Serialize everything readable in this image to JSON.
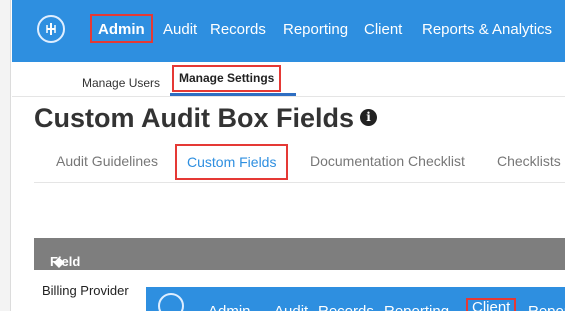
{
  "nav": {
    "items": [
      "Admin",
      "Audit",
      "Records",
      "Reporting",
      "Client",
      "Reports & Analytics"
    ]
  },
  "subnav": {
    "manage_users": "Manage Users",
    "manage_settings": "Manage Settings"
  },
  "page": {
    "title": "Custom Audit Box Fields"
  },
  "tabs": [
    "Audit Guidelines",
    "Custom Fields",
    "Documentation Checklist",
    "Checklists"
  ],
  "table": {
    "header": "Field Name",
    "rows": [
      "Billing Provider"
    ]
  },
  "overlay_nav": {
    "items": [
      "Admin",
      "Audit",
      "Records",
      "Reporting",
      "Client",
      "Reports & Analytics"
    ]
  },
  "colors": {
    "nav_bg": "#2e8fe0",
    "highlight": "#e53935",
    "header_bg": "#7e7e7e"
  }
}
